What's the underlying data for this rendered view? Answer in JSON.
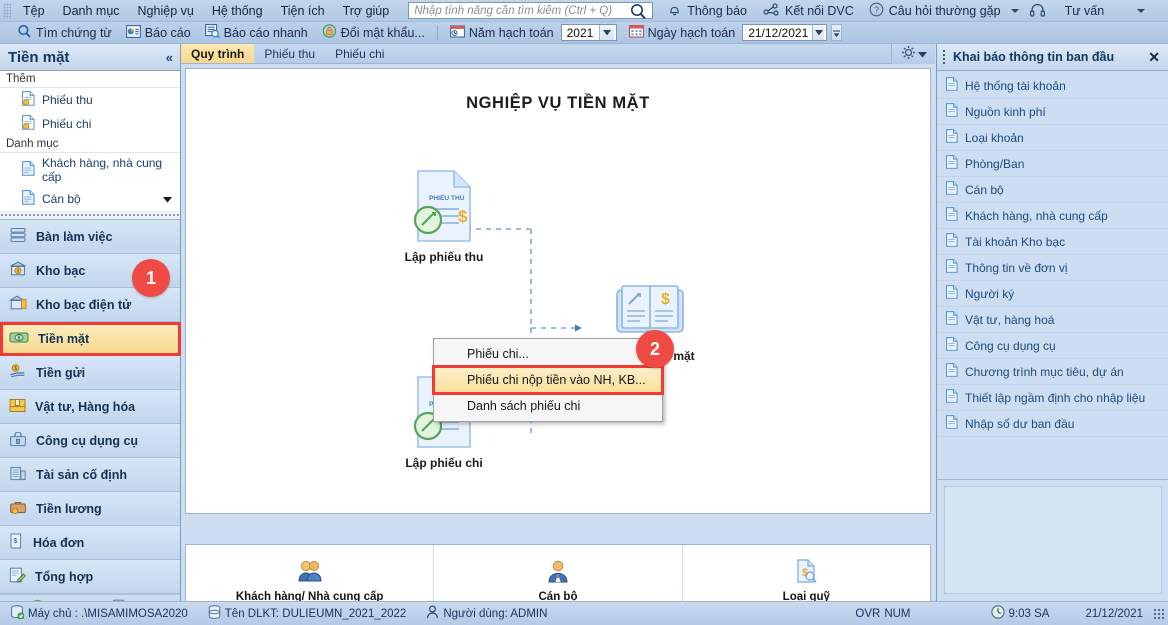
{
  "menubar": {
    "items": [
      "Tệp",
      "Danh mục",
      "Nghiệp vụ",
      "Hệ thống",
      "Tiện ích",
      "Trợ giúp"
    ],
    "search_placeholder": "Nhập tính năng cần tìm kiếm (Ctrl + Q)",
    "search_value": "",
    "notify_label": "Thông báo",
    "dvc_label": "Kết nối DVC",
    "faq_label": "Câu hỏi thường gặp",
    "consult_label": "Tư vấn"
  },
  "toolbar": {
    "find_voucher": "Tìm chứng từ",
    "report": "Báo cáo",
    "quick_report": "Báo cáo nhanh",
    "change_password": "Đổi mật khẩu...",
    "fiscal_year_label": "Năm hạch toán",
    "fiscal_year_value": "2021",
    "posting_date_label": "Ngày hạch toán",
    "posting_date_value": "21/12/2021"
  },
  "sidebar": {
    "title": "Tiền mặt",
    "collapse_icon": "«",
    "group_add_title": "Thêm",
    "add_links": [
      {
        "label": "Phiếu thu",
        "icon": "new-document-icon"
      },
      {
        "label": "Phiếu chi",
        "icon": "new-document-icon"
      }
    ],
    "group_category_title": "Danh mục",
    "category_links": [
      {
        "label": "Khách hàng, nhà cung cấp",
        "icon": "document-icon"
      },
      {
        "label": "Cán bộ",
        "icon": "document-icon"
      }
    ],
    "modules": [
      {
        "label": "Bàn làm việc",
        "icon": "workbench-icon",
        "active": false
      },
      {
        "label": "Kho bạc",
        "icon": "treasury-icon",
        "active": false
      },
      {
        "label": "Kho bạc điện tử",
        "icon": "e-treasury-icon",
        "active": false
      },
      {
        "label": "Tiền mặt",
        "icon": "cash-icon",
        "active": true
      },
      {
        "label": "Tiền gửi",
        "icon": "deposit-icon",
        "active": false
      },
      {
        "label": "Vật tư, Hàng hóa",
        "icon": "goods-icon",
        "active": false
      },
      {
        "label": "Công cụ dụng cụ",
        "icon": "tools-icon",
        "active": false
      },
      {
        "label": "Tài sản cố định",
        "icon": "fixed-asset-icon",
        "active": false
      },
      {
        "label": "Tiền lương",
        "icon": "payroll-icon",
        "active": false
      },
      {
        "label": "Hóa đơn",
        "icon": "invoice-icon",
        "active": false
      },
      {
        "label": "Tổng hợp",
        "icon": "general-ledger-icon",
        "active": false
      }
    ],
    "tray_icons": [
      "shield-check-icon",
      "folder-check-icon",
      "briefcase-check-icon",
      "edit-document-icon",
      "more-chevrons-icon"
    ]
  },
  "main": {
    "tabs": [
      {
        "label": "Quy trình",
        "selected": true
      },
      {
        "label": "Phiếu thu",
        "selected": false
      },
      {
        "label": "Phiếu chi",
        "selected": false
      }
    ],
    "diagram_title": "NGHIỆP VỤ TIỀN MẶT",
    "nodes": [
      {
        "label": "Lập phiếu thu",
        "icon": "receipt-voucher-icon",
        "badge": "PHIẾU THU"
      },
      {
        "label": "Lập phiếu chi",
        "icon": "payment-voucher-icon",
        "badge": "PHIẾU CHI"
      },
      {
        "label": "Sổ quỹ tiền mặt",
        "icon": "cash-book-icon",
        "badge": ""
      }
    ],
    "bottom_items": [
      {
        "label": "Khách hàng/ Nhà cung cấp",
        "icon": "customers-icon"
      },
      {
        "label": "Cán bộ",
        "icon": "employee-icon"
      },
      {
        "label": "Loại quỹ",
        "icon": "fund-type-icon"
      }
    ]
  },
  "context_menu": {
    "items": [
      {
        "label": "Phiếu chi...",
        "highlighted": false
      },
      {
        "label": "Phiếu chi nộp tiền vào NH, KB...",
        "highlighted": true
      },
      {
        "label": "Danh sách phiếu chi",
        "highlighted": false
      }
    ]
  },
  "right_panel": {
    "title": "Khai báo thông tin ban đầu",
    "close_label": "✕",
    "items": [
      "Hệ thống tài khoản",
      "Nguồn kinh phí",
      "Loại khoản",
      "Phòng/Ban",
      "Cán bộ",
      "Khách hàng, nhà cung cấp",
      "Tài khoản Kho bạc",
      "Thông tin về đơn vị",
      "Người ký",
      "Vật tư, hàng hoá",
      "Công cụ dụng cụ",
      "Chương trình mục tiêu, dự án",
      "Thiết lập ngầm định cho nhập liệu",
      "Nhập số dư ban đầu"
    ]
  },
  "statusbar": {
    "server": "Máy chủ : .\\MISAMIMOSA2020",
    "database": "Tên DLKT: DULIEUMN_2021_2022",
    "user": "Người dùng: ADMIN",
    "ovr": "OVR",
    "num": "NUM",
    "time": "9:03 SA",
    "date": "21/12/2021"
  },
  "callouts": [
    {
      "number": "1"
    },
    {
      "number": "2"
    }
  ],
  "colors": {
    "accent_red": "#ef4a44",
    "highlight_yellow": "#f6d88c",
    "chrome_blue": "#b2c9e4",
    "text_blue": "#1b4a7c"
  }
}
